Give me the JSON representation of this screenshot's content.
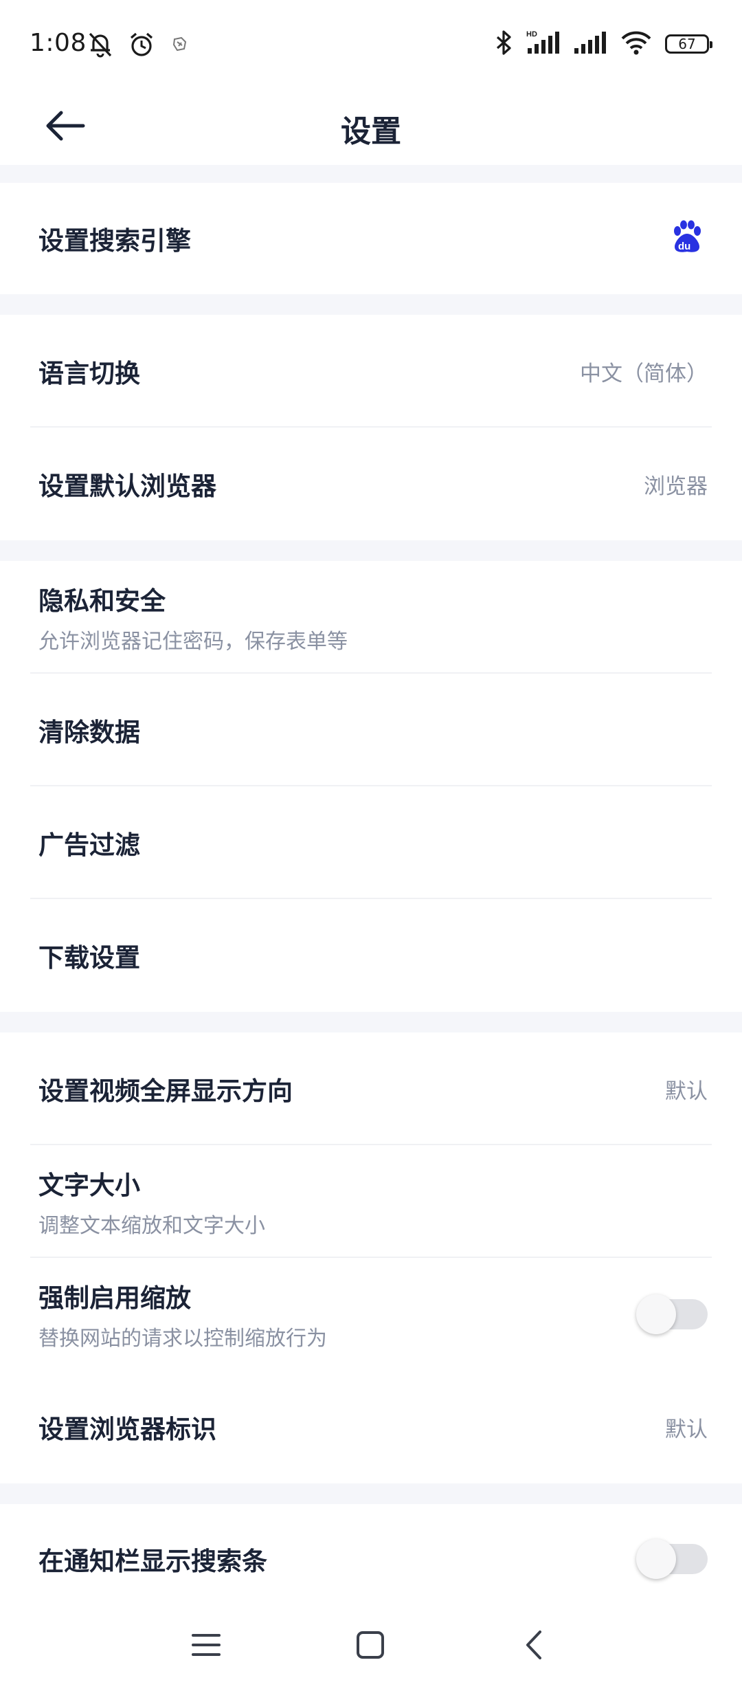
{
  "status_bar": {
    "time": "1:08",
    "battery": "67",
    "icons": [
      "muted-bell-icon",
      "alarm-icon",
      "notification-icon",
      "bluetooth-icon",
      "signal-hd-icon",
      "signal-icon",
      "wifi-icon",
      "battery-icon"
    ]
  },
  "header": {
    "title": "设置",
    "back_icon": "arrow-left-icon"
  },
  "colors": {
    "title_text": "#1b2336",
    "secondary_text": "#8a91a2",
    "section_gap": "#f5f6fa",
    "baidu_blue": "#2932e1"
  },
  "settings": {
    "search_engine": {
      "label": "设置搜索引擎",
      "icon": "baidu-icon"
    },
    "language": {
      "label": "语言切换",
      "value": "中文（简体）"
    },
    "default_browser": {
      "label": "设置默认浏览器",
      "value": "浏览器"
    },
    "privacy": {
      "label": "隐私和安全",
      "subtitle": "允许浏览器记住密码，保存表单等"
    },
    "clear_data": {
      "label": "清除数据"
    },
    "ad_filter": {
      "label": "广告过滤"
    },
    "download": {
      "label": "下载设置"
    },
    "video_orientation": {
      "label": "设置视频全屏显示方向",
      "value": "默认"
    },
    "text_size": {
      "label": "文字大小",
      "subtitle": "调整文本缩放和文字大小"
    },
    "force_zoom": {
      "label": "强制启用缩放",
      "subtitle": "替换网站的请求以控制缩放行为",
      "enabled": false
    },
    "user_agent": {
      "label": "设置浏览器标识",
      "value": "默认"
    },
    "notification_search": {
      "label": "在通知栏显示搜索条",
      "enabled": false
    }
  },
  "nav": {
    "menu_icon": "menu-icon",
    "home_icon": "home-square-icon",
    "back_icon": "back-chevron-icon"
  }
}
